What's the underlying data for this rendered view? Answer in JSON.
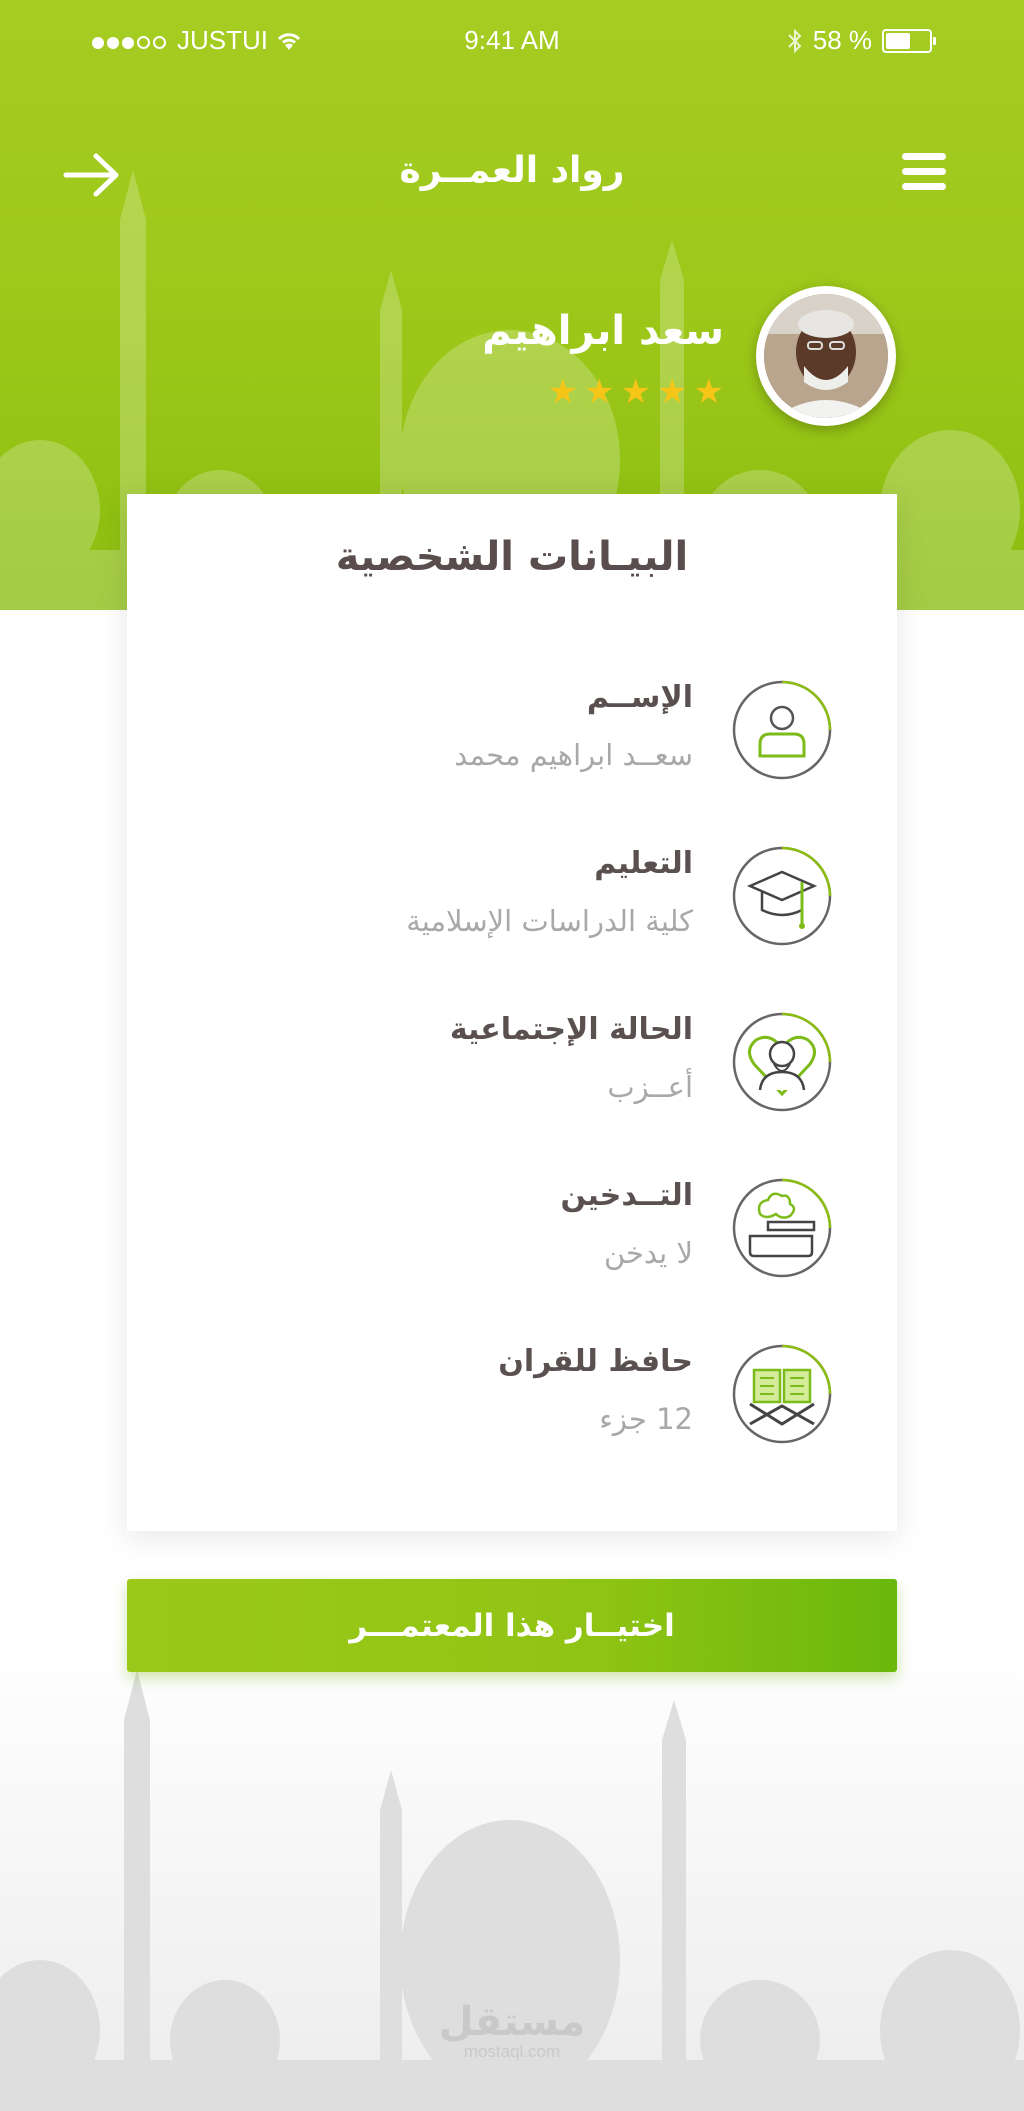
{
  "status_bar": {
    "carrier": "JUSTUI",
    "time": "9:41 AM",
    "battery": "58 %"
  },
  "nav": {
    "title": "رواد العمــرة"
  },
  "profile": {
    "name": "سعد ابراهيم",
    "rating": 5
  },
  "card": {
    "title": "البيـانات الشخصية",
    "items": [
      {
        "label": "الإســم",
        "value": "سعــد ابراهيم محمد",
        "icon": "person-icon"
      },
      {
        "label": "التعليم",
        "value": "كلية الدراسات الإسلامية",
        "icon": "graduation-cap-icon"
      },
      {
        "label": "الحالة الإجتماعية",
        "value": "أعــزب",
        "icon": "man-heart-icon"
      },
      {
        "label": "التــدخين",
        "value": "لا يدخن",
        "icon": "cigarette-icon"
      },
      {
        "label": "حافظ للقران",
        "value": "12 جزء",
        "icon": "quran-book-icon"
      }
    ]
  },
  "cta": {
    "label": "اختيــار هذا المعتمـــر"
  },
  "watermark": {
    "arabic": "مستقل",
    "latin": "mostaql.com"
  },
  "colors": {
    "primary": "#9cc719",
    "primary_dark": "#6ab80b",
    "title_text": "#5a4d4d",
    "muted_text": "#a8a8a8",
    "star": "#f5c518"
  }
}
